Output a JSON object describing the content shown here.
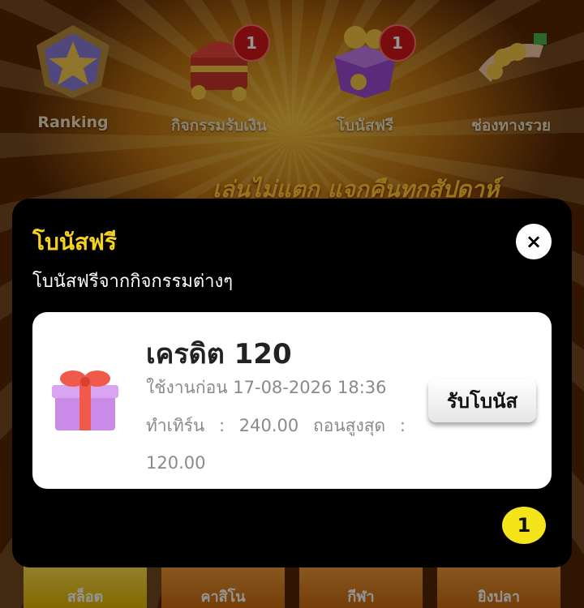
{
  "top_menu": [
    {
      "label": "Ranking",
      "icon": "star-trophy-icon",
      "badge": ""
    },
    {
      "label": "กิจกรรมรับเงิน",
      "icon": "treasure-chest-icon",
      "badge": "1"
    },
    {
      "label": "โบนัสฟรี",
      "icon": "gift-box-icon",
      "badge": "1"
    },
    {
      "label": "ช่องทางรวย",
      "icon": "coin-hand-icon",
      "badge": ""
    }
  ],
  "banner": {
    "text": "เล่นไม่แตก แจกคืนทุกสัปดาห์"
  },
  "bottom_categories": [
    {
      "label": "สล็อต"
    },
    {
      "label": "คาสิโน"
    },
    {
      "label": "กีฬา"
    },
    {
      "label": "ยิงปลา"
    }
  ],
  "modal": {
    "title": "โบนัสฟรี",
    "subtitle": "โบนัสฟรีจากกิจกรรมต่างๆ",
    "close_icon": "×",
    "card": {
      "title": "เครดิต 120",
      "expiry": "ใช้งานก่อน 17-08-2026 18:36",
      "turnover": "ทำเทิร์น : 240.00 ถอนสูงสุด :",
      "max_withdraw": "120.00",
      "claim_label": "รับโบนัส",
      "icon": "gift-icon"
    },
    "page_indicator": "1"
  },
  "colors": {
    "accent_yellow": "#f4d21f",
    "badge_red": "#d01818",
    "modal_bg": "#000000",
    "card_bg": "#ffffff",
    "muted_text": "#8a8a8a"
  }
}
